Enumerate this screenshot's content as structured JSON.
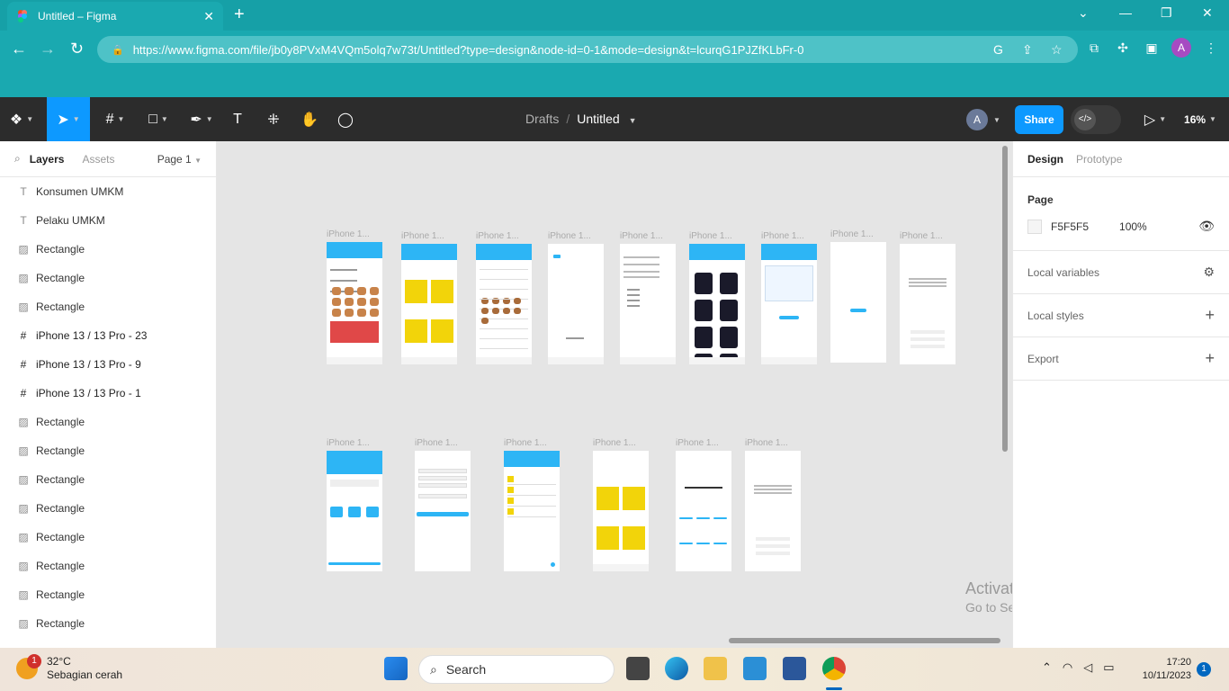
{
  "browser": {
    "tab_title": "Untitled – Figma",
    "tab_close": "✕",
    "new_tab": "+",
    "url": "https://www.figma.com/file/jb0y8PVxM4VQm5olq7w73t/Untitled?type=design&node-id=0-1&mode=design&t=lcurqG1PJZfKLbFr-0",
    "profile_initial": "A",
    "window_controls": [
      "⌄",
      "—",
      "❐",
      "✕"
    ]
  },
  "toolbar": {
    "breadcrumb_parent": "Drafts",
    "breadcrumb_sep": "/",
    "file_name": "Untitled",
    "avatar_initial": "A",
    "share_label": "Share",
    "zoom": "16%"
  },
  "layers_panel": {
    "tab_layers": "Layers",
    "tab_assets": "Assets",
    "page_selector": "Page 1",
    "layers": [
      {
        "name": "Konsumen UMKM",
        "type": "text"
      },
      {
        "name": "Pelaku UMKM",
        "type": "text"
      },
      {
        "name": "Rectangle",
        "type": "image"
      },
      {
        "name": "Rectangle",
        "type": "image"
      },
      {
        "name": "Rectangle",
        "type": "image"
      },
      {
        "name": "iPhone 13 / 13 Pro - 23",
        "type": "frame"
      },
      {
        "name": "iPhone 13 / 13 Pro - 9",
        "type": "frame"
      },
      {
        "name": "iPhone 13 / 13 Pro - 1",
        "type": "frame"
      },
      {
        "name": "Rectangle",
        "type": "image"
      },
      {
        "name": "Rectangle",
        "type": "image"
      },
      {
        "name": "Rectangle",
        "type": "image"
      },
      {
        "name": "Rectangle",
        "type": "image"
      },
      {
        "name": "Rectangle",
        "type": "image"
      },
      {
        "name": "Rectangle",
        "type": "image"
      },
      {
        "name": "Rectangle",
        "type": "image"
      },
      {
        "name": "Rectangle",
        "type": "image"
      }
    ]
  },
  "canvas": {
    "frame_label": "iPhone 1...",
    "activate_line1": "Activate Windows",
    "activate_line2": "Go to Settings to activate Windows.",
    "help": "?"
  },
  "design_panel": {
    "tab_design": "Design",
    "tab_prototype": "Prototype",
    "page_heading": "Page",
    "page_color": "F5F5F5",
    "page_opacity": "100%",
    "local_variables": "Local variables",
    "local_styles": "Local styles",
    "export": "Export"
  },
  "taskbar": {
    "temperature": "32°C",
    "weather": "Sebagian cerah",
    "weather_badge": "1",
    "search_placeholder": "Search",
    "time": "17:20",
    "date": "10/11/2023",
    "notifications": "1"
  },
  "colors": {
    "chrome": "#1aa9b0",
    "figma_toolbar": "#2c2c2c",
    "accent": "#0d99ff",
    "mockup_blue": "#2db5f5"
  }
}
